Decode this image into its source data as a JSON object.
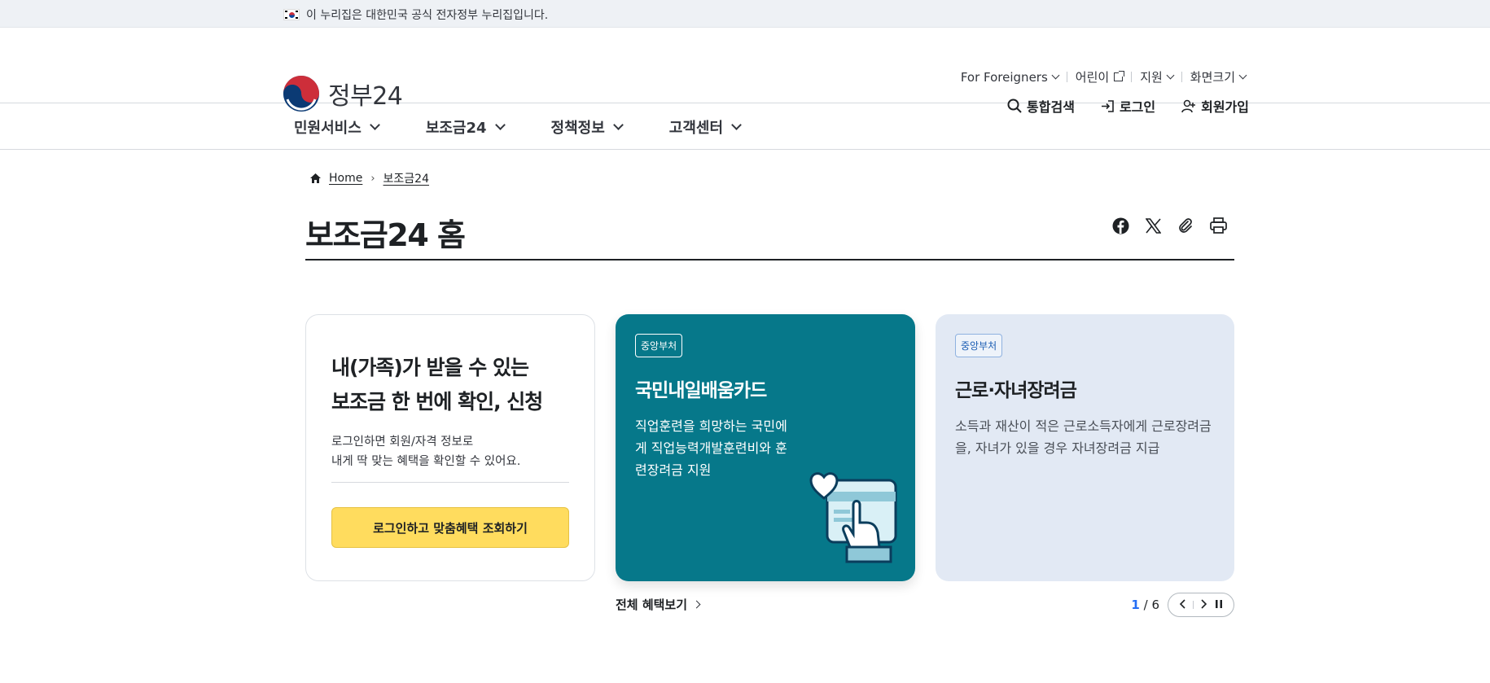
{
  "notice": {
    "text": "이 누리집은 대한민국 공식 전자정부 누리집입니다."
  },
  "header": {
    "logo_text": "정부24",
    "util": [
      "For Foreigners",
      "어린이",
      "지원",
      "화면크기"
    ],
    "search_label": "통합검색",
    "login_label": "로그인",
    "signup_label": "회원가입"
  },
  "gnb": [
    "민원서비스",
    "보조금24",
    "정책정보",
    "고객센터"
  ],
  "breadcrumb": {
    "home": "Home",
    "current": "보조금24"
  },
  "page_title": "보조금24 홈",
  "share_icons": [
    "facebook-icon",
    "x-icon",
    "link-icon",
    "print-icon"
  ],
  "cards": {
    "intro": {
      "title_line1": "내(가족)가 받을 수 있는",
      "title_line2": "보조금 한 번에 확인, 신청",
      "desc_line1": "로그인하면 회원/자격 정보로",
      "desc_line2": "내게 딱 맞는 혜택을 확인할 수 있어요.",
      "button": "로그인하고 맞춤혜택 조회하기"
    },
    "slide1": {
      "badge": "중앙부처",
      "title": "국민내일배움카드",
      "text": "직업훈련을 희망하는 국민에게 직업능력개발훈련비와 훈련장려금 지원"
    },
    "slide2": {
      "badge": "중앙부처",
      "title": "근로·자녀장려금",
      "text": "소득과 재산이 적은 근로소득자에게 근로장려금을, 자녀가 있을 경우 자녀장려금 지급"
    }
  },
  "more_label": "전체 혜택보기",
  "pager": {
    "current": "1",
    "total": "/ 6"
  },
  "colors": {
    "card_teal": "#06788a",
    "card_blue": "#e2e9f4",
    "button_yellow": "#ffdc5e",
    "pager_accent": "#256ef4"
  }
}
